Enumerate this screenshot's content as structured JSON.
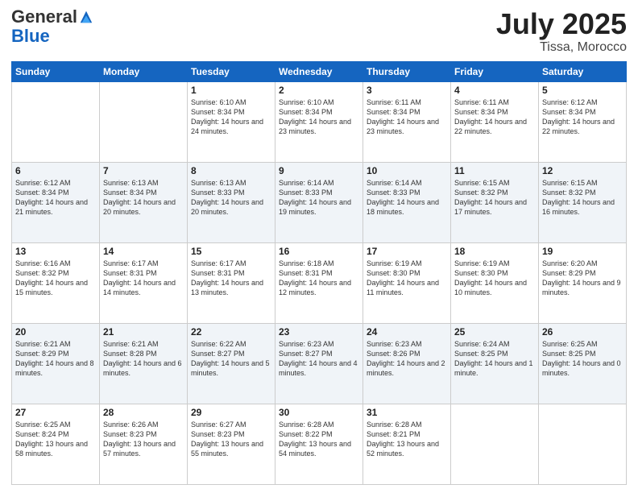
{
  "header": {
    "logo_general": "General",
    "logo_blue": "Blue",
    "month": "July 2025",
    "location": "Tissa, Morocco"
  },
  "weekdays": [
    "Sunday",
    "Monday",
    "Tuesday",
    "Wednesday",
    "Thursday",
    "Friday",
    "Saturday"
  ],
  "weeks": [
    [
      {
        "day": "",
        "empty": true
      },
      {
        "day": "",
        "empty": true
      },
      {
        "day": "1",
        "sunrise": "6:10 AM",
        "sunset": "8:34 PM",
        "daylight": "14 hours and 24 minutes."
      },
      {
        "day": "2",
        "sunrise": "6:10 AM",
        "sunset": "8:34 PM",
        "daylight": "14 hours and 23 minutes."
      },
      {
        "day": "3",
        "sunrise": "6:11 AM",
        "sunset": "8:34 PM",
        "daylight": "14 hours and 23 minutes."
      },
      {
        "day": "4",
        "sunrise": "6:11 AM",
        "sunset": "8:34 PM",
        "daylight": "14 hours and 22 minutes."
      },
      {
        "day": "5",
        "sunrise": "6:12 AM",
        "sunset": "8:34 PM",
        "daylight": "14 hours and 22 minutes."
      }
    ],
    [
      {
        "day": "6",
        "sunrise": "6:12 AM",
        "sunset": "8:34 PM",
        "daylight": "14 hours and 21 minutes."
      },
      {
        "day": "7",
        "sunrise": "6:13 AM",
        "sunset": "8:34 PM",
        "daylight": "14 hours and 20 minutes."
      },
      {
        "day": "8",
        "sunrise": "6:13 AM",
        "sunset": "8:33 PM",
        "daylight": "14 hours and 20 minutes."
      },
      {
        "day": "9",
        "sunrise": "6:14 AM",
        "sunset": "8:33 PM",
        "daylight": "14 hours and 19 minutes."
      },
      {
        "day": "10",
        "sunrise": "6:14 AM",
        "sunset": "8:33 PM",
        "daylight": "14 hours and 18 minutes."
      },
      {
        "day": "11",
        "sunrise": "6:15 AM",
        "sunset": "8:32 PM",
        "daylight": "14 hours and 17 minutes."
      },
      {
        "day": "12",
        "sunrise": "6:15 AM",
        "sunset": "8:32 PM",
        "daylight": "14 hours and 16 minutes."
      }
    ],
    [
      {
        "day": "13",
        "sunrise": "6:16 AM",
        "sunset": "8:32 PM",
        "daylight": "14 hours and 15 minutes."
      },
      {
        "day": "14",
        "sunrise": "6:17 AM",
        "sunset": "8:31 PM",
        "daylight": "14 hours and 14 minutes."
      },
      {
        "day": "15",
        "sunrise": "6:17 AM",
        "sunset": "8:31 PM",
        "daylight": "14 hours and 13 minutes."
      },
      {
        "day": "16",
        "sunrise": "6:18 AM",
        "sunset": "8:31 PM",
        "daylight": "14 hours and 12 minutes."
      },
      {
        "day": "17",
        "sunrise": "6:19 AM",
        "sunset": "8:30 PM",
        "daylight": "14 hours and 11 minutes."
      },
      {
        "day": "18",
        "sunrise": "6:19 AM",
        "sunset": "8:30 PM",
        "daylight": "14 hours and 10 minutes."
      },
      {
        "day": "19",
        "sunrise": "6:20 AM",
        "sunset": "8:29 PM",
        "daylight": "14 hours and 9 minutes."
      }
    ],
    [
      {
        "day": "20",
        "sunrise": "6:21 AM",
        "sunset": "8:29 PM",
        "daylight": "14 hours and 8 minutes."
      },
      {
        "day": "21",
        "sunrise": "6:21 AM",
        "sunset": "8:28 PM",
        "daylight": "14 hours and 6 minutes."
      },
      {
        "day": "22",
        "sunrise": "6:22 AM",
        "sunset": "8:27 PM",
        "daylight": "14 hours and 5 minutes."
      },
      {
        "day": "23",
        "sunrise": "6:23 AM",
        "sunset": "8:27 PM",
        "daylight": "14 hours and 4 minutes."
      },
      {
        "day": "24",
        "sunrise": "6:23 AM",
        "sunset": "8:26 PM",
        "daylight": "14 hours and 2 minutes."
      },
      {
        "day": "25",
        "sunrise": "6:24 AM",
        "sunset": "8:25 PM",
        "daylight": "14 hours and 1 minute."
      },
      {
        "day": "26",
        "sunrise": "6:25 AM",
        "sunset": "8:25 PM",
        "daylight": "14 hours and 0 minutes."
      }
    ],
    [
      {
        "day": "27",
        "sunrise": "6:25 AM",
        "sunset": "8:24 PM",
        "daylight": "13 hours and 58 minutes."
      },
      {
        "day": "28",
        "sunrise": "6:26 AM",
        "sunset": "8:23 PM",
        "daylight": "13 hours and 57 minutes."
      },
      {
        "day": "29",
        "sunrise": "6:27 AM",
        "sunset": "8:23 PM",
        "daylight": "13 hours and 55 minutes."
      },
      {
        "day": "30",
        "sunrise": "6:28 AM",
        "sunset": "8:22 PM",
        "daylight": "13 hours and 54 minutes."
      },
      {
        "day": "31",
        "sunrise": "6:28 AM",
        "sunset": "8:21 PM",
        "daylight": "13 hours and 52 minutes."
      },
      {
        "day": "",
        "empty": true
      },
      {
        "day": "",
        "empty": true
      }
    ]
  ]
}
